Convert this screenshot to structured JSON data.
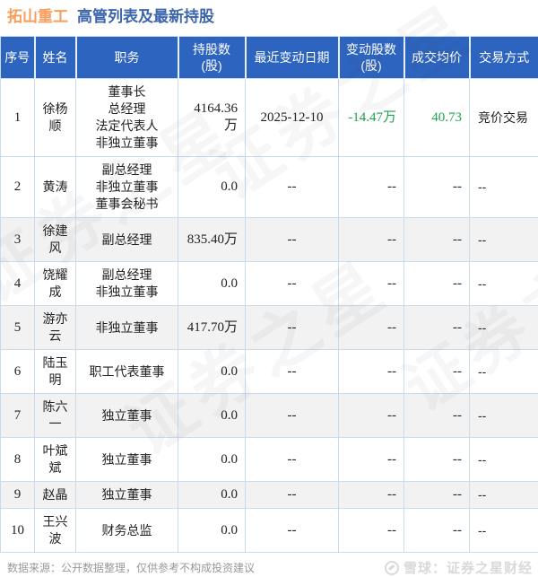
{
  "title": {
    "stock": "拓山重工",
    "suffix": "高管列表及最新持股"
  },
  "colors": {
    "stock_orange": "#F99D5B",
    "title_blue": "#3B65AD",
    "header_bg": "#2D64BF",
    "header_text": "#FFFFFF",
    "green_change": "#1FA14E",
    "border": "#C9DCEE",
    "alt_row_bg": "#F2F2F2",
    "source_text": "#999999",
    "brand_text": "#D9D9D9"
  },
  "table": {
    "headers": [
      "序号",
      "姓名",
      "职务",
      [
        "持股数",
        "(股)"
      ],
      "最近变动日期",
      [
        "变动股数",
        "(股)"
      ],
      "成交均价",
      "交易方式"
    ],
    "rows": [
      {
        "no": "1",
        "name": "徐杨顺",
        "positions": [
          "董事长",
          "总经理",
          "法定代表人",
          "非独立董事"
        ],
        "shares": "4164.36万",
        "date": "2025-12-10",
        "change": "-14.47万",
        "price": "40.73",
        "method": "竞价交易",
        "green": true
      },
      {
        "no": "2",
        "name": "黄涛",
        "positions": [
          "副总经理",
          "非独立董事",
          "董事会秘书"
        ],
        "shares": "0.0",
        "date": "--",
        "change": "--",
        "price": "--",
        "method": "--",
        "green": false
      },
      {
        "no": "3",
        "name": "徐建风",
        "positions": [
          "副总经理"
        ],
        "shares": "835.40万",
        "date": "--",
        "change": "--",
        "price": "--",
        "method": "--",
        "green": false
      },
      {
        "no": "4",
        "name": "饶耀成",
        "positions": [
          "副总经理",
          "非独立董事"
        ],
        "shares": "0.0",
        "date": "--",
        "change": "--",
        "price": "--",
        "method": "--",
        "green": false
      },
      {
        "no": "5",
        "name": "游亦云",
        "positions": [
          "非独立董事"
        ],
        "shares": "417.70万",
        "date": "--",
        "change": "--",
        "price": "--",
        "method": "--",
        "green": false
      },
      {
        "no": "6",
        "name": "陆玉明",
        "positions": [
          "职工代表董事"
        ],
        "shares": "0.0",
        "date": "--",
        "change": "--",
        "price": "--",
        "method": "--",
        "green": false
      },
      {
        "no": "7",
        "name": "陈六一",
        "positions": [
          "独立董事"
        ],
        "shares": "0.0",
        "date": "--",
        "change": "--",
        "price": "--",
        "method": "--",
        "green": false
      },
      {
        "no": "8",
        "name": "叶斌斌",
        "positions": [
          "独立董事"
        ],
        "shares": "0.0",
        "date": "--",
        "change": "--",
        "price": "--",
        "method": "--",
        "green": false
      },
      {
        "no": "9",
        "name": "赵晶",
        "positions": [
          "独立董事"
        ],
        "shares": "0.0",
        "date": "--",
        "change": "--",
        "price": "--",
        "method": "--",
        "green": false
      },
      {
        "no": "10",
        "name": "王兴波",
        "positions": [
          "财务总监"
        ],
        "shares": "0.0",
        "date": "--",
        "change": "--",
        "price": "--",
        "method": "--",
        "green": false
      }
    ]
  },
  "footer": {
    "source": "数据来源：公开数据整理，仅供参考不构成投资建议",
    "brand": "雪球：证券之星财经"
  },
  "watermark": {
    "text": "证券之星"
  }
}
